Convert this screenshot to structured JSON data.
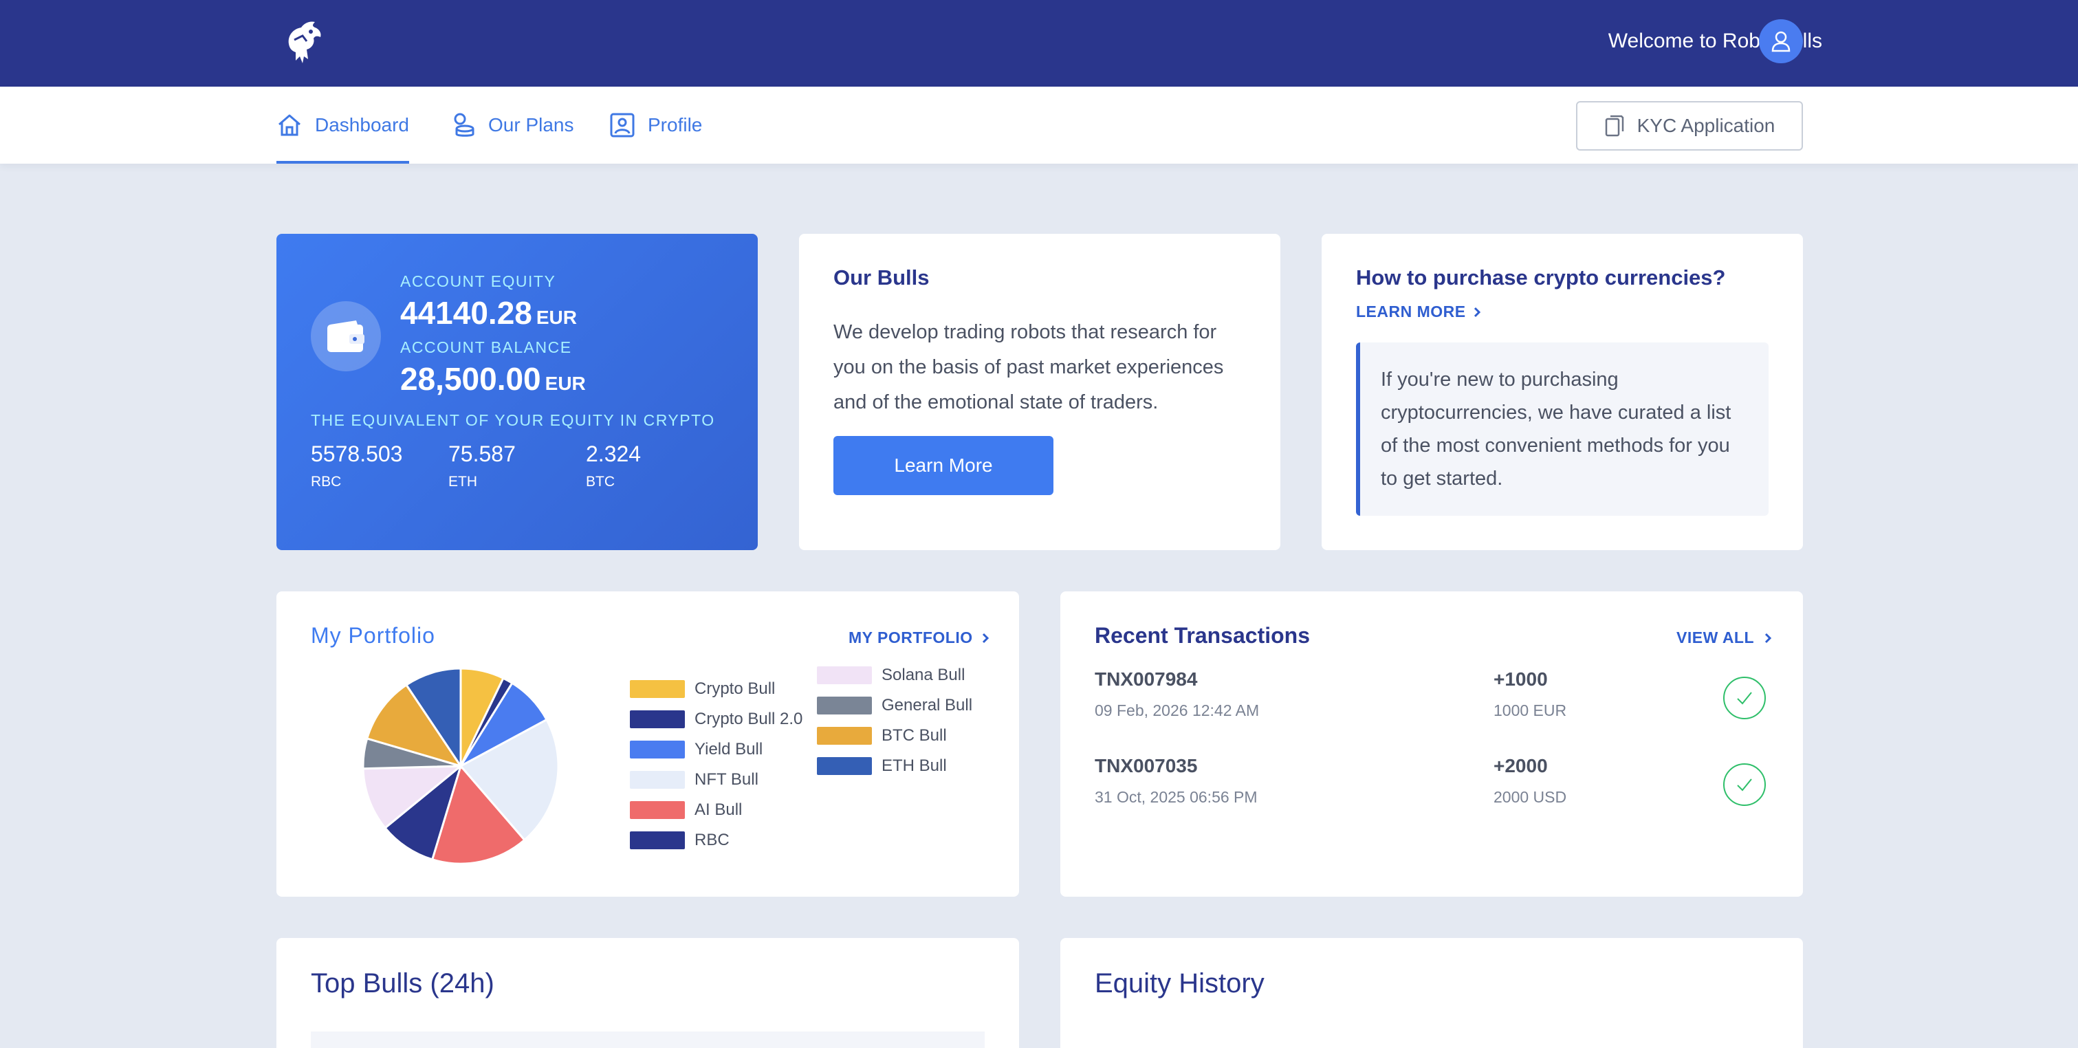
{
  "header": {
    "welcome": "Welcome to RobotBulls"
  },
  "nav": {
    "items": [
      {
        "label": "Dashboard",
        "icon": "home-icon",
        "active": true
      },
      {
        "label": "Our Plans",
        "icon": "coins-icon",
        "active": false
      },
      {
        "label": "Profile",
        "icon": "user-card-icon",
        "active": false
      }
    ],
    "kyc_label": "KYC Application"
  },
  "equity": {
    "equity_label": "ACCOUNT EQUITY",
    "equity_value": "44140.28",
    "equity_unit": "EUR",
    "balance_label": "ACCOUNT BALANCE",
    "balance_value": "28,500.00",
    "balance_unit": "EUR",
    "crypto_label": "THE EQUIVALENT OF YOUR EQUITY IN CRYPTO",
    "crypto": [
      {
        "value": "5578.503",
        "symbol": "RBC"
      },
      {
        "value": "75.587",
        "symbol": "ETH"
      },
      {
        "value": "2.324",
        "symbol": "BTC"
      }
    ]
  },
  "bulls": {
    "title": "Our Bulls",
    "text": "We develop trading robots that research for you on the basis of past market experiences and of the emotional state of traders.",
    "button": "Learn More"
  },
  "howto": {
    "title": "How to purchase crypto currencies?",
    "link": "LEARN MORE",
    "quote": "If you're new to purchasing cryptocurrencies, we have curated a list of the most convenient methods for you to get started."
  },
  "portfolio": {
    "title": "My Portfolio",
    "link": "MY PORTFOLIO",
    "legend": [
      {
        "label": "Crypto Bull",
        "color": "#f5c142"
      },
      {
        "label": "Crypto Bull 2.0",
        "color": "#2a368c"
      },
      {
        "label": "Yield Bull",
        "color": "#4a7cf0"
      },
      {
        "label": "NFT Bull",
        "color": "#e6edf9"
      },
      {
        "label": "AI Bull",
        "color": "#ef6b6b"
      },
      {
        "label": "RBC",
        "color": "#2a368c"
      },
      {
        "label": "Solana Bull",
        "color": "#f1e3f6"
      },
      {
        "label": "General Bull",
        "color": "#7a8596"
      },
      {
        "label": "BTC Bull",
        "color": "#e8aa3c"
      },
      {
        "label": "ETH Bull",
        "color": "#345fb5"
      }
    ],
    "slices": [
      6.5,
      1.5,
      7.5,
      19.5,
      14.5,
      8.5,
      9.5,
      4.5,
      10.0,
      8.5
    ]
  },
  "transactions": {
    "title": "Recent Transactions",
    "view_all": "VIEW ALL",
    "rows": [
      {
        "id": "TNX007984",
        "date": "09 Feb, 2026 12:42 AM",
        "amount": "+1000",
        "sub": "1000 EUR"
      },
      {
        "id": "TNX007035",
        "date": "31 Oct, 2025 06:56 PM",
        "amount": "+2000",
        "sub": "2000 USD"
      }
    ]
  },
  "top_bulls": {
    "title": "Top Bulls (24h)"
  },
  "equity_history": {
    "title": "Equity History"
  },
  "colors": {
    "brand": "#2a368c",
    "accent": "#3f7bf0",
    "success": "#2fbf6a"
  }
}
